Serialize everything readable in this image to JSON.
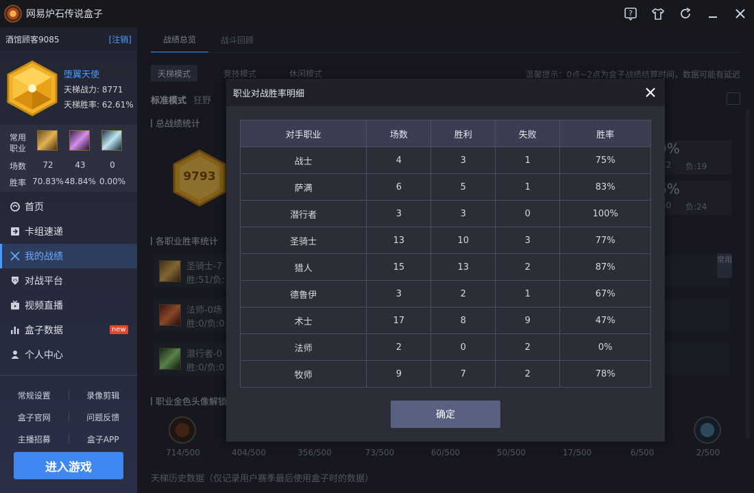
{
  "app": {
    "title": "网易炉石传说盒子"
  },
  "sidebar": {
    "username": "酒馆顾客9085",
    "logout_label": "[注销]",
    "profile": {
      "rank_name": "堕翼天使",
      "ladder_power": "天梯战力: 8771",
      "ladder_winrate": "天梯胜率: 62.61%"
    },
    "stats": {
      "common_label_1": "常用",
      "common_label_2": "职业",
      "games_label": "场数",
      "winrate_label": "胜率",
      "games": [
        "72",
        "43",
        "0"
      ],
      "winrates": [
        "70.83%",
        "48.84%",
        "0.00%"
      ]
    },
    "nav": [
      {
        "label": "首页",
        "icon": "home-icon"
      },
      {
        "label": "卡组速递",
        "icon": "deck-icon"
      },
      {
        "label": "我的战绩",
        "icon": "swords-icon"
      },
      {
        "label": "对战平台",
        "icon": "vs-icon"
      },
      {
        "label": "视频直播",
        "icon": "video-icon"
      },
      {
        "label": "盒子数据",
        "icon": "chart-icon",
        "badge": "new"
      },
      {
        "label": "个人中心",
        "icon": "user-icon"
      }
    ],
    "links": [
      [
        "常规设置",
        "录像剪辑"
      ],
      [
        "盒子官网",
        "问题反馈"
      ],
      [
        "主播招募",
        "盒子APP"
      ]
    ],
    "enter_button": "进入游戏"
  },
  "main": {
    "tabs": [
      "战绩总览",
      "战斗回顾"
    ],
    "modes": [
      "天梯模式",
      "竞技模式",
      "休闲模式"
    ],
    "tip": "温馨提示：0点~2点为盒子战绩结算时间，数据可能有延迟",
    "sub_modes": [
      "标准模式",
      "狂野"
    ],
    "section_total": "总战绩统计",
    "score": "9793",
    "side_cards": [
      {
        "pct": "9%",
        "detail": ":42",
        "lose": "负:19"
      },
      {
        "pct": "6%",
        "detail": ":30",
        "lose": "负:24"
      }
    ],
    "section_class": "各职业胜率统计",
    "class_rows": [
      {
        "name": "圣骑士-7",
        "stats": "胜:51/负:"
      },
      {
        "name": "法师-0场",
        "stats": "胜:0/负:0"
      },
      {
        "name": "潜行者-0",
        "stats": "胜:0/负:0"
      }
    ],
    "common_tag": "常用",
    "section_gold": "职业金色头像解锁",
    "portrait_values": [
      "714/500",
      "404/500",
      "356/500",
      "73/500",
      "60/500",
      "50/500",
      "17/500",
      "6/500",
      "2/500"
    ],
    "footer_note": "天梯历史数据（仅记录用户赛季最后使用盒子时的数据）"
  },
  "modal": {
    "title": "职业对战胜率明细",
    "columns": [
      "对手职业",
      "场数",
      "胜利",
      "失败",
      "胜率"
    ],
    "rows": [
      [
        "战士",
        "4",
        "3",
        "1",
        "75%"
      ],
      [
        "萨满",
        "6",
        "5",
        "1",
        "83%"
      ],
      [
        "潜行者",
        "3",
        "3",
        "0",
        "100%"
      ],
      [
        "圣骑士",
        "13",
        "10",
        "3",
        "77%"
      ],
      [
        "猎人",
        "15",
        "13",
        "2",
        "87%"
      ],
      [
        "德鲁伊",
        "3",
        "2",
        "1",
        "67%"
      ],
      [
        "术士",
        "17",
        "8",
        "9",
        "47%"
      ],
      [
        "法师",
        "2",
        "0",
        "2",
        "0%"
      ],
      [
        "牧师",
        "9",
        "7",
        "2",
        "78%"
      ]
    ],
    "confirm_label": "确定"
  }
}
